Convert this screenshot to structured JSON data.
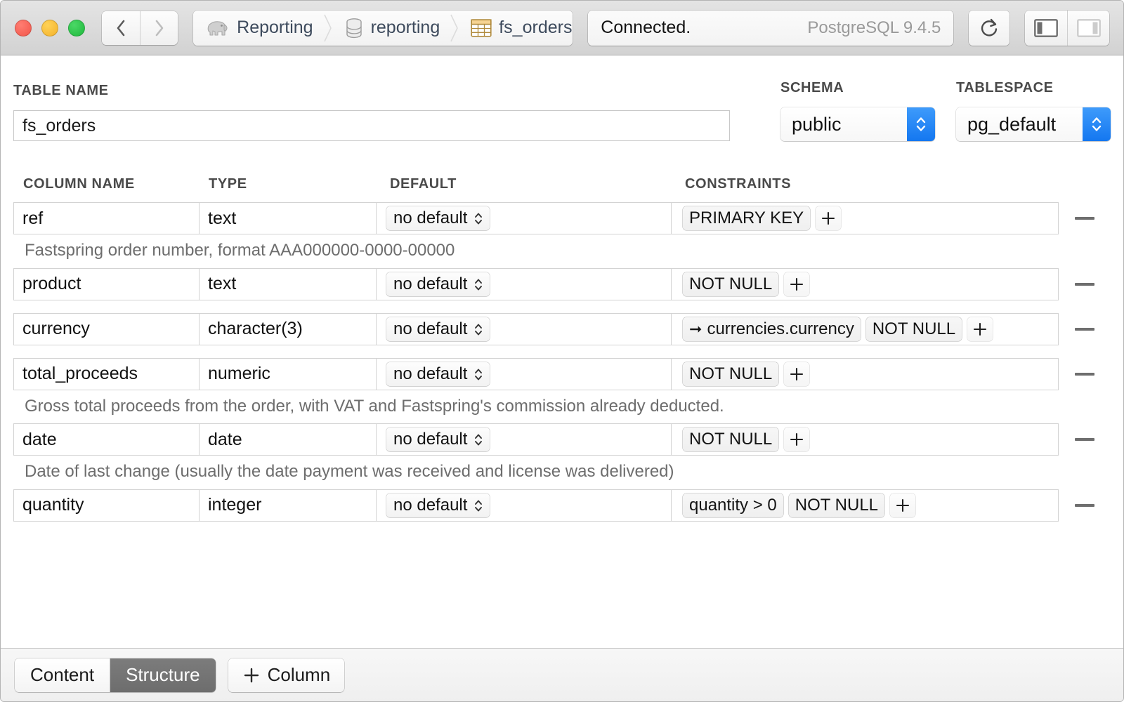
{
  "window": {
    "traffic_lights": [
      {
        "name": "close",
        "color": "#f2564a"
      },
      {
        "name": "minimize",
        "color": "#f4b22a"
      },
      {
        "name": "zoom",
        "color": "#1eb83c"
      }
    ]
  },
  "toolbar": {
    "back_icon": "chevron-left-icon",
    "forward_icon": "chevron-right-icon",
    "breadcrumb": [
      {
        "label": "Reporting",
        "icon": "elephant-icon"
      },
      {
        "label": "reporting",
        "icon": "database-icon"
      },
      {
        "label": "fs_orders",
        "icon": "table-icon"
      }
    ],
    "status": "Connected.",
    "version": "PostgreSQL 9.4.5",
    "refresh_icon": "refresh-icon",
    "left_panel_icon": "left-sidebar-icon",
    "right_panel_icon": "right-sidebar-icon"
  },
  "form": {
    "table_name_label": "TABLE NAME",
    "table_name_value": "fs_orders",
    "table_name_placeholder": "Table name",
    "schema_label": "SCHEMA",
    "schema_value": "public",
    "tablespace_label": "TABLESPACE",
    "tablespace_value": "pg_default"
  },
  "grid": {
    "headers": {
      "column_name": "COLUMN NAME",
      "type": "TYPE",
      "default": "DEFAULT",
      "constraints": "CONSTRAINTS"
    },
    "rows": [
      {
        "name": "ref",
        "type": "text",
        "default": "no default",
        "constraints": [
          {
            "text": "PRIMARY KEY",
            "fk": false
          }
        ],
        "comment": "Fastspring order number, format AAA000000-0000-00000"
      },
      {
        "name": "product",
        "type": "text",
        "default": "no default",
        "constraints": [
          {
            "text": "NOT NULL",
            "fk": false
          }
        ],
        "comment": ""
      },
      {
        "name": "currency",
        "type": "character(3)",
        "default": "no default",
        "constraints": [
          {
            "text": "currencies.currency",
            "fk": true
          },
          {
            "text": "NOT NULL",
            "fk": false
          }
        ],
        "comment": ""
      },
      {
        "name": "total_proceeds",
        "type": "numeric",
        "default": "no default",
        "constraints": [
          {
            "text": "NOT NULL",
            "fk": false
          }
        ],
        "comment": "Gross total proceeds from the order, with VAT and Fastspring's commission already deducted."
      },
      {
        "name": "date",
        "type": "date",
        "default": "no default",
        "constraints": [
          {
            "text": "NOT NULL",
            "fk": false
          }
        ],
        "comment": "Date of last change (usually the date payment was received and license was delivered)"
      },
      {
        "name": "quantity",
        "type": "integer",
        "default": "no default",
        "constraints": [
          {
            "text": "quantity > 0",
            "fk": false
          },
          {
            "text": "NOT NULL",
            "fk": false
          }
        ],
        "comment": ""
      }
    ],
    "add_constraint_icon": "plus-icon",
    "remove_row_icon": "minus-icon"
  },
  "footer": {
    "tabs": [
      {
        "label": "Content",
        "active": false
      },
      {
        "label": "Structure",
        "active": true
      }
    ],
    "add_column_label": "Column",
    "add_column_icon": "plus-icon"
  },
  "colors": {
    "accent_blue": "#1477f0",
    "active_tab_bg": "#6d6d6d",
    "comment_text": "#6d6d6d",
    "header_text": "#4a4a4a"
  }
}
